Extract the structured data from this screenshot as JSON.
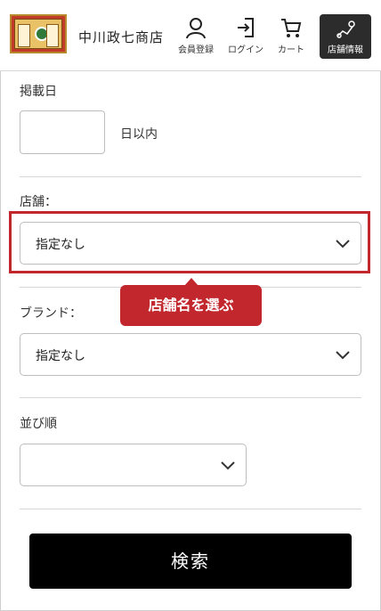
{
  "header": {
    "logo_name": "中川政七商店",
    "nav": [
      {
        "label": "会員登録",
        "icon": "person-icon"
      },
      {
        "label": "ログイン",
        "icon": "login-icon"
      },
      {
        "label": "カート",
        "icon": "cart-icon"
      }
    ],
    "store_button": {
      "label": "店舗情報",
      "icon": "map-pin-icon"
    }
  },
  "form": {
    "date": {
      "label": "掲載日",
      "value": "",
      "suffix": "日以内"
    },
    "store": {
      "label": "店舗：",
      "selected": "指定なし"
    },
    "brand": {
      "label": "ブランド：",
      "selected": "指定なし"
    },
    "sort": {
      "label": "並び順",
      "selected": ""
    },
    "submit_label": "検索"
  },
  "annotation": {
    "callout_text": "店舗名を選ぶ",
    "color": "#c1272d"
  },
  "colors": {
    "accent": "#c1272d",
    "button": "#000000",
    "store_button": "#2c2c2c"
  }
}
